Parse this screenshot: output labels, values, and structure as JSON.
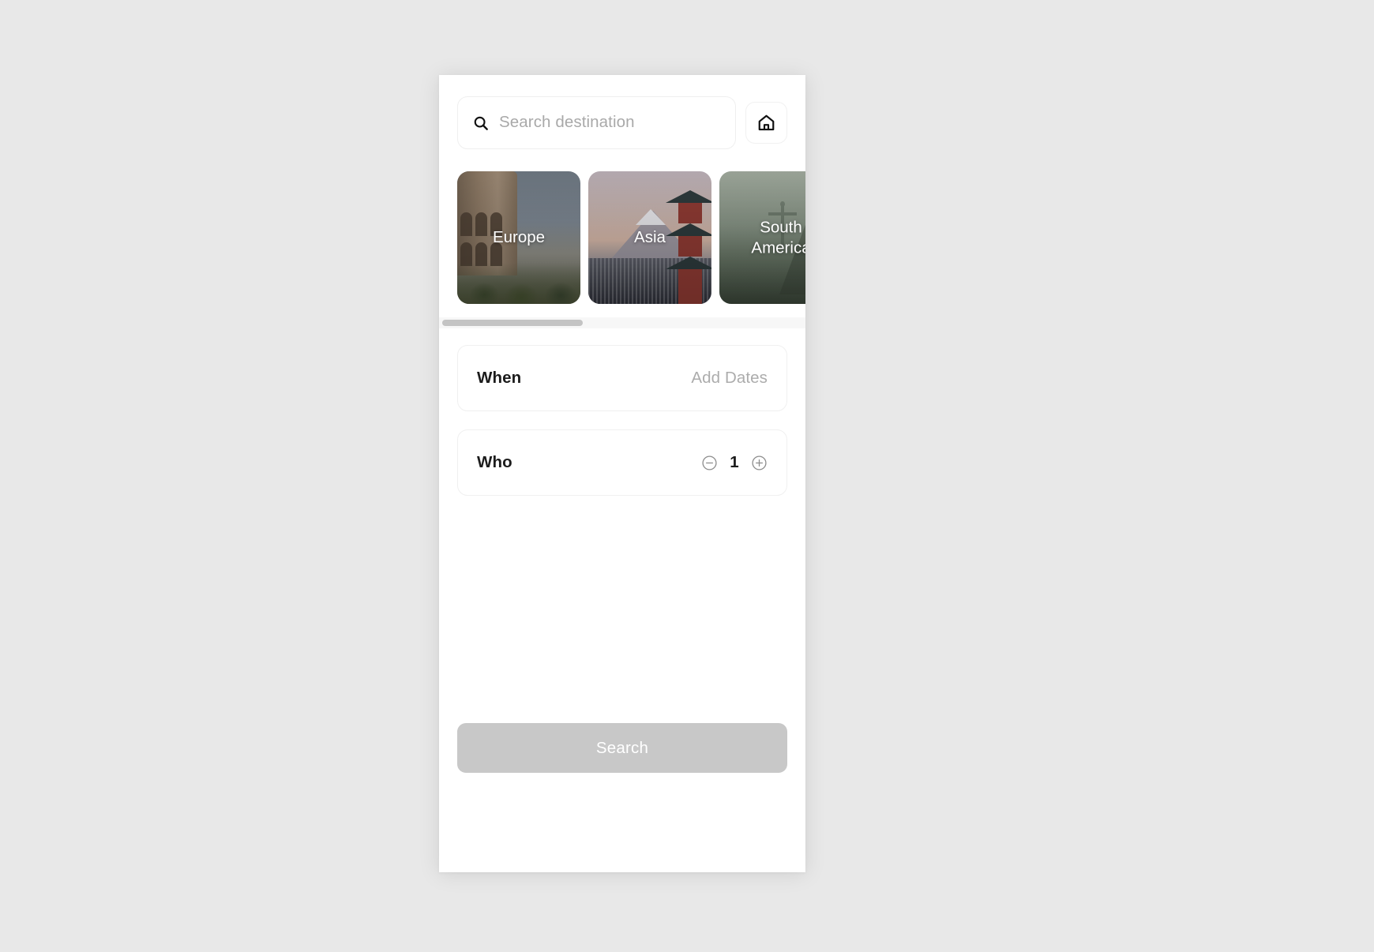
{
  "search": {
    "placeholder": "Search destination",
    "icon": "search-icon"
  },
  "home_button": {
    "icon": "home-icon"
  },
  "destinations": {
    "items": [
      {
        "label": "Europe",
        "scene": "colosseum"
      },
      {
        "label": "Asia",
        "scene": "mount-fuji-pagoda"
      },
      {
        "label": "South\nAmerica",
        "scene": "christ-the-redeemer"
      }
    ]
  },
  "fields": {
    "when": {
      "label": "When",
      "value": "Add Dates"
    },
    "who": {
      "label": "Who",
      "count": "1",
      "decrement_icon": "minus-circle-icon",
      "increment_icon": "plus-circle-icon"
    }
  },
  "submit": {
    "label": "Search"
  },
  "colors": {
    "background": "#e8e8e8",
    "panel": "#ffffff",
    "text_primary": "#1c1c1c",
    "text_muted": "#acacac",
    "button_disabled": "#c8c8c8",
    "scroll_thumb": "#c4c4c4",
    "scroll_track": "#f7f7f7"
  }
}
